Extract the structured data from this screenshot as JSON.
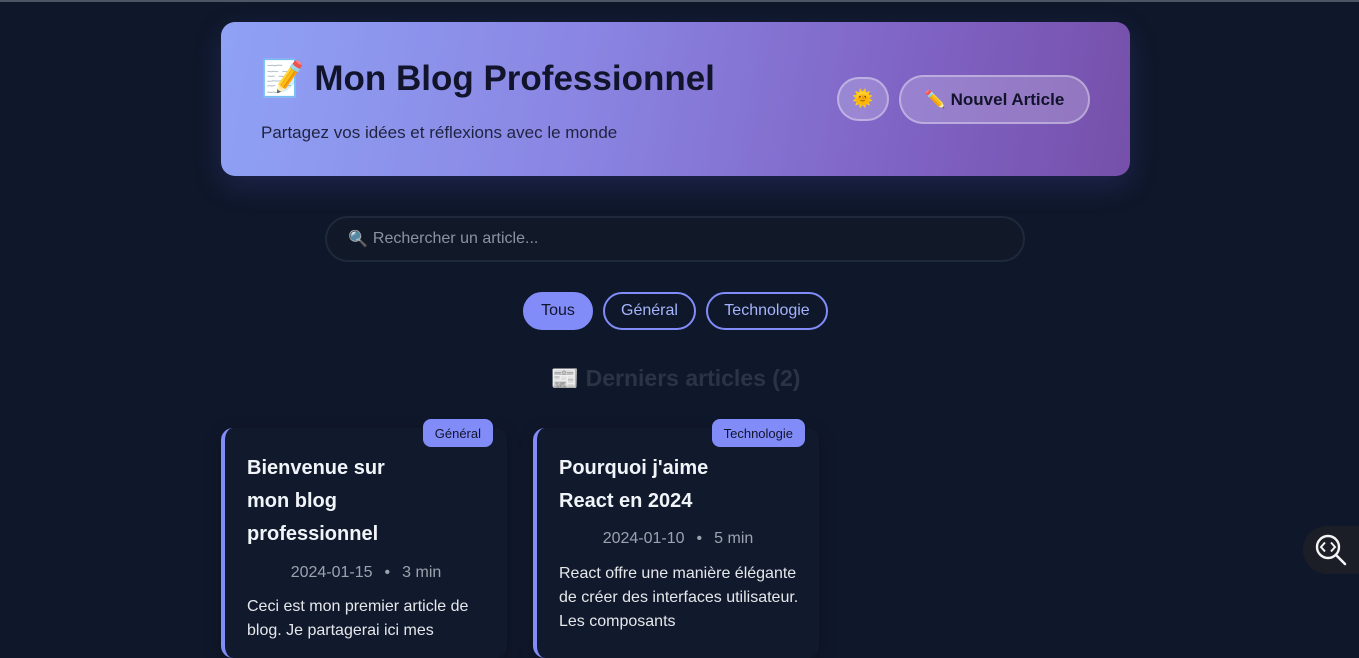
{
  "header": {
    "title_icon": "📝",
    "title": "Mon Blog Professionnel",
    "subtitle": "Partagez vos idées et réflexions avec le monde",
    "theme_toggle_icon": "🌞",
    "new_article_icon": "✏️",
    "new_article_label": "Nouvel Article"
  },
  "search": {
    "icon": "🔍",
    "placeholder": "Rechercher un article..."
  },
  "filters": [
    {
      "label": "Tous",
      "active": true
    },
    {
      "label": "Général",
      "active": false
    },
    {
      "label": "Technologie",
      "active": false
    }
  ],
  "section": {
    "icon": "📰",
    "title": "Derniers articles (2)"
  },
  "articles": [
    {
      "category": "Général",
      "title": "Bienvenue sur mon blog professionnel",
      "date": "2024-01-15",
      "read_time": "3 min",
      "excerpt": "Ceci est mon premier article de blog. Je partagerai ici mes"
    },
    {
      "category": "Technologie",
      "title": "Pourquoi j'aime React en 2024",
      "date": "2024-01-10",
      "read_time": "5 min",
      "excerpt": "React offre une manière élégante de créer des interfaces utilisateur. Les composants"
    }
  ],
  "meta_separator": "•",
  "colors": {
    "background": "#0f172a",
    "accent": "#818cf8",
    "header_gradient_start": "#8fa2f5",
    "header_gradient_end": "#7650aa"
  }
}
